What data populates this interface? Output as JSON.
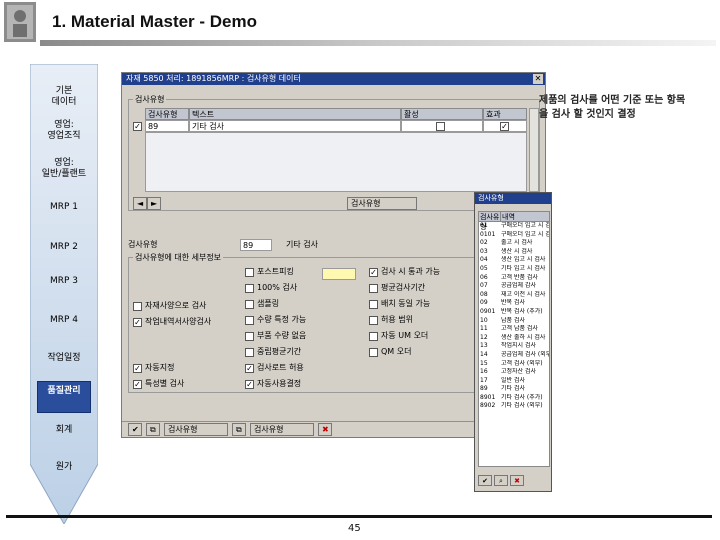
{
  "slide": {
    "title": "1. Material Master - Demo",
    "page_number": "45"
  },
  "process_steps": [
    {
      "label": "기본\n데이터",
      "active": false
    },
    {
      "label": "영업:\n영업조직",
      "active": false
    },
    {
      "label": "영업:\n일반/플랜트",
      "active": false
    },
    {
      "label": "MRP 1",
      "active": false
    },
    {
      "label": "MRP 2",
      "active": false
    },
    {
      "label": "MRP 3",
      "active": false
    },
    {
      "label": "MRP 4",
      "active": false
    },
    {
      "label": "작업일정",
      "active": false
    },
    {
      "label": "품질관리",
      "active": true
    },
    {
      "label": "회계",
      "active": false
    },
    {
      "label": "원가",
      "active": false
    }
  ],
  "annotation": {
    "text": "제품의 검사를 어떤 기준 또는 항목을 검사 할 것인지 결정"
  },
  "sap_window": {
    "title": "자재 5850 처리: 1891856MRP : 검사유형 데이터",
    "group_title": "검사유형",
    "table_headers": [
      "검사유형",
      "텍스트",
      "활성",
      "효과"
    ],
    "table_row": {
      "code": "89",
      "text": "기타 검사"
    },
    "inspection_type_btn": "검사유형",
    "detail": {
      "insp_type_label": "검사유형",
      "insp_type_value": "89",
      "insp_type_text": "기타 검사",
      "detail_title": "검사유형에 대한 세부정보",
      "left_col": [
        {
          "label": "자재사양으로 검사",
          "checked": false
        },
        {
          "label": "작업내역서사양검사",
          "checked": true
        }
      ],
      "mid_col": [
        {
          "label": "포스트피킹",
          "checked": false
        },
        {
          "label": "100% 검사",
          "checked": false
        },
        {
          "label": "샘플링",
          "checked": false
        },
        {
          "label": "수량 특정 가능",
          "checked": false
        },
        {
          "label": "부품 수량 없음",
          "checked": false
        },
        {
          "label": "중립평균기간",
          "checked": false
        }
      ],
      "right_col": [
        {
          "label": "검사 시 통과 가능",
          "checked": true
        },
        {
          "label": "평균검사기간",
          "checked": false
        },
        {
          "label": "배치 동일 가능",
          "checked": false
        },
        {
          "label": "허용 범위",
          "checked": false
        },
        {
          "label": "자동 UM 오더",
          "checked": false
        },
        {
          "label": "QM 오더",
          "checked": false
        }
      ],
      "bottom_left": [
        {
          "label": "자동지정",
          "checked": true
        },
        {
          "label": "특성별 검사",
          "checked": true
        }
      ],
      "bottom_mid": [
        {
          "label": "검사로트 허용",
          "checked": true
        },
        {
          "label": "자동사용결정",
          "checked": true
        }
      ]
    },
    "toolbar_buttons": [
      "검사유형",
      "검사유형"
    ]
  },
  "popup": {
    "title": "검사유형",
    "headers": [
      "검사유형",
      "내역"
    ],
    "rows": [
      {
        "code": "01",
        "text": "구매오더 입고 시 검사"
      },
      {
        "code": "0101",
        "text": "구매오더 입고 시 검사 (추가)"
      },
      {
        "code": "02",
        "text": "출고 시 검사"
      },
      {
        "code": "03",
        "text": "생산 시 검사"
      },
      {
        "code": "04",
        "text": "생산 입고 시 검사"
      },
      {
        "code": "05",
        "text": "기타 입고 시 검사"
      },
      {
        "code": "06",
        "text": "고객 반품 검사"
      },
      {
        "code": "07",
        "text": "공급업체 감사"
      },
      {
        "code": "08",
        "text": "재고 이전 시 검사"
      },
      {
        "code": "09",
        "text": "반복 검사"
      },
      {
        "code": "0901",
        "text": "반복 검사 (추가)"
      },
      {
        "code": "10",
        "text": "납품 검사"
      },
      {
        "code": "11",
        "text": "고객 납품 검사"
      },
      {
        "code": "12",
        "text": "생산 출하 시 검사"
      },
      {
        "code": "13",
        "text": "작업지시 검사"
      },
      {
        "code": "14",
        "text": "공급업체 검사 (외부)"
      },
      {
        "code": "15",
        "text": "고객 검사 (외부)"
      },
      {
        "code": "16",
        "text": "고정자산 검사"
      },
      {
        "code": "17",
        "text": "일반 검사"
      },
      {
        "code": "89",
        "text": "기타 검사"
      },
      {
        "code": "8901",
        "text": "기타 검사 (추가)"
      },
      {
        "code": "8902",
        "text": "기타 검사 (외부)"
      }
    ]
  }
}
